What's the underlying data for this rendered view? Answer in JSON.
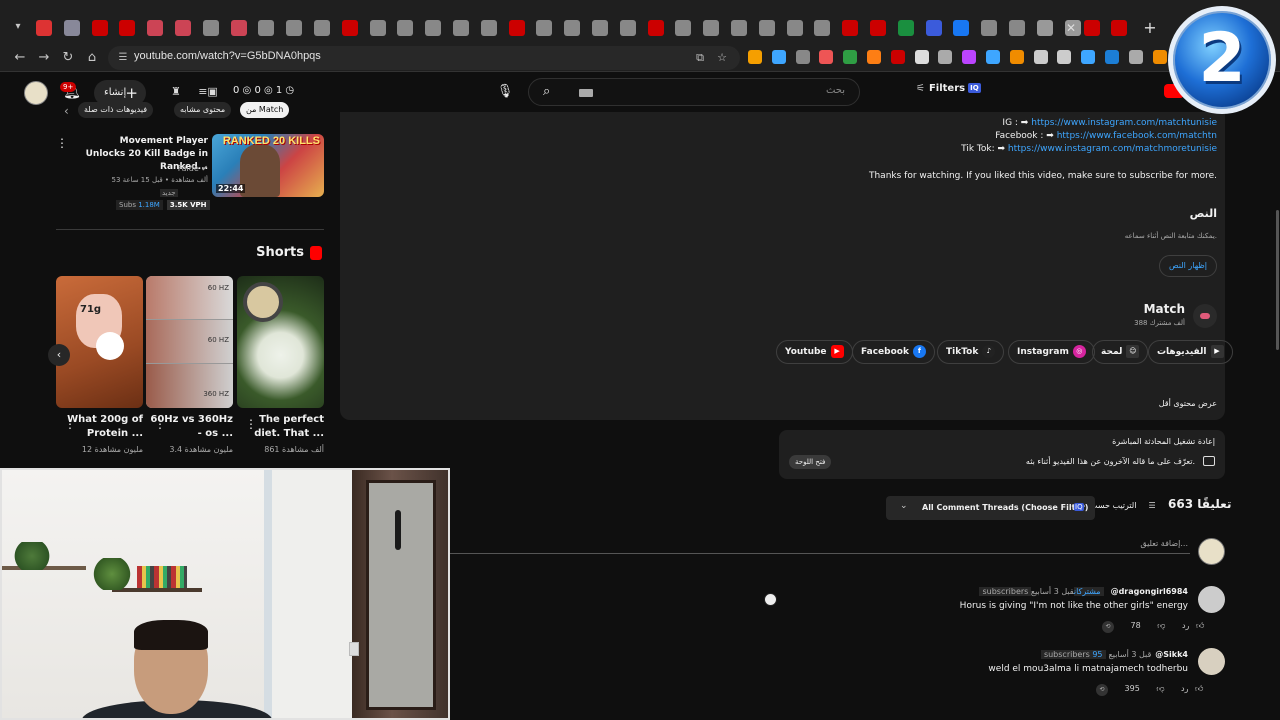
{
  "browser": {
    "url": "youtube.com/watch?v=G5bDNA0hpqs",
    "tab_favicon_colors": [
      "#d33",
      "#889",
      "#c00",
      "#c00",
      "#c45",
      "#c45",
      "#888",
      "#c45",
      "#888",
      "#888",
      "#888",
      "#c00",
      "#888",
      "#888",
      "#888",
      "#888",
      "#888",
      "#c00",
      "#888",
      "#888",
      "#888",
      "#888",
      "#c00",
      "#888",
      "#888",
      "#888",
      "#888",
      "#888",
      "#888",
      "#c00",
      "#c00",
      "#1a8f3f",
      "#3b5bdb",
      "#1877f2",
      "#888",
      "#888",
      "#999",
      "#999",
      "#c00",
      "#c00"
    ],
    "extension_colors": [
      "#f59f00",
      "#3ea6ff",
      "#888",
      "#e55",
      "#2f9e44",
      "#fd7e14",
      "#c00",
      "#ddd",
      "#aaa",
      "#b4f",
      "#3ea6ff",
      "#f08c00",
      "#ccc",
      "#ccc",
      "#3ea6ff",
      "#1c7ed6",
      "#aaa",
      "#f08c00",
      "#fab005"
    ]
  },
  "overlay_badge": {
    "number": "2"
  },
  "masthead": {
    "notif_count": "9+",
    "create_label": "إنشاء",
    "stats": "0 ◎  0 ◎  1 ◷",
    "search_placeholder": "بحث",
    "filters_label": "Filters",
    "filters_tag": "IQ"
  },
  "left": {
    "chips": [
      "فيديوهات ذات صلة",
      "محتوى مشابه",
      "من Match"
    ],
    "related": {
      "title": "Movement Player Unlocks 20 Kill Badge in Ranked...",
      "channel": "Faide",
      "meta": "53 ألف مشاهدة • قبل 15 ساعة",
      "new_badge": "جديد",
      "duration": "22:44",
      "thumb_text": "RANKED 20 KILLS",
      "subs_label": "Subs",
      "subs_value": "1.18M",
      "vph": "3.5K VPH"
    },
    "shorts_heading": "Shorts",
    "shorts": [
      {
        "title": "What 200g of Protein ...",
        "views": "12 مليون مشاهدة",
        "thumb_text": "71g"
      },
      {
        "title": "60Hz vs 360Hz - os ...",
        "views": "3.4 مليون مشاهدة",
        "thumb_labels": [
          "60 HZ",
          "60 HZ",
          "360 HZ"
        ]
      },
      {
        "title": "The perfect diet. That ...",
        "views": "861 ألف مشاهدة"
      }
    ]
  },
  "description": {
    "links": [
      {
        "label": "IG : ➡",
        "url": "https://www.instagram.com/matchtunisie"
      },
      {
        "label": "Facebook : ➡",
        "url": "https://www.facebook.com/matchtn"
      },
      {
        "label": "Tik Tok: ➡",
        "url": "https://www.instagram.com/matchmoretunisie"
      }
    ],
    "thanks": "Thanks for watching. If you liked this video, make sure to subscribe for more.",
    "transcript_title": "النص",
    "transcript_sub": "يمكنك متابعة النص أثناء سماعه.",
    "transcript_btn": "إظهار النص",
    "channel_name": "Match",
    "channel_subs": "388 ألف مشترك",
    "channel_links": [
      "الفيديوهات",
      "لمحة",
      "Instagram",
      "TikTok",
      "Facebook",
      "Youtube"
    ],
    "show_less": "عرض محتوى أقل"
  },
  "live_chat": {
    "title": "إعادة تشغيل المحادثة المباشرة",
    "desc": "تعرّف على ما قاله الآخرون عن هذا الفيديو أثناء بثه.",
    "button": "فتح اللوحة"
  },
  "comments": {
    "count": "663 تعليقًا",
    "sort_label": "الترتيب حسب",
    "filter_label": "All Comment Threads (Choose Filter)",
    "filter_tag": "IQ",
    "add_placeholder": "إضافة تعليق...",
    "items": [
      {
        "author": "@dragongirl6984",
        "time": "قبل 3 أسابيع",
        "subs_tag_num": "مشتركان",
        "subs_tag_label": "subscribers",
        "text": "Horus is giving \"I'm not like the other girls\" energy",
        "likes": "78",
        "reply": "رد"
      },
      {
        "author": "@Sikk4",
        "time": "قبل 3 أسابيع",
        "subs_tag_num": "95",
        "subs_tag_label": "subscribers",
        "text": "weld el mou3alma li matnajamech todherbu",
        "likes": "395",
        "reply": "رد"
      }
    ]
  }
}
